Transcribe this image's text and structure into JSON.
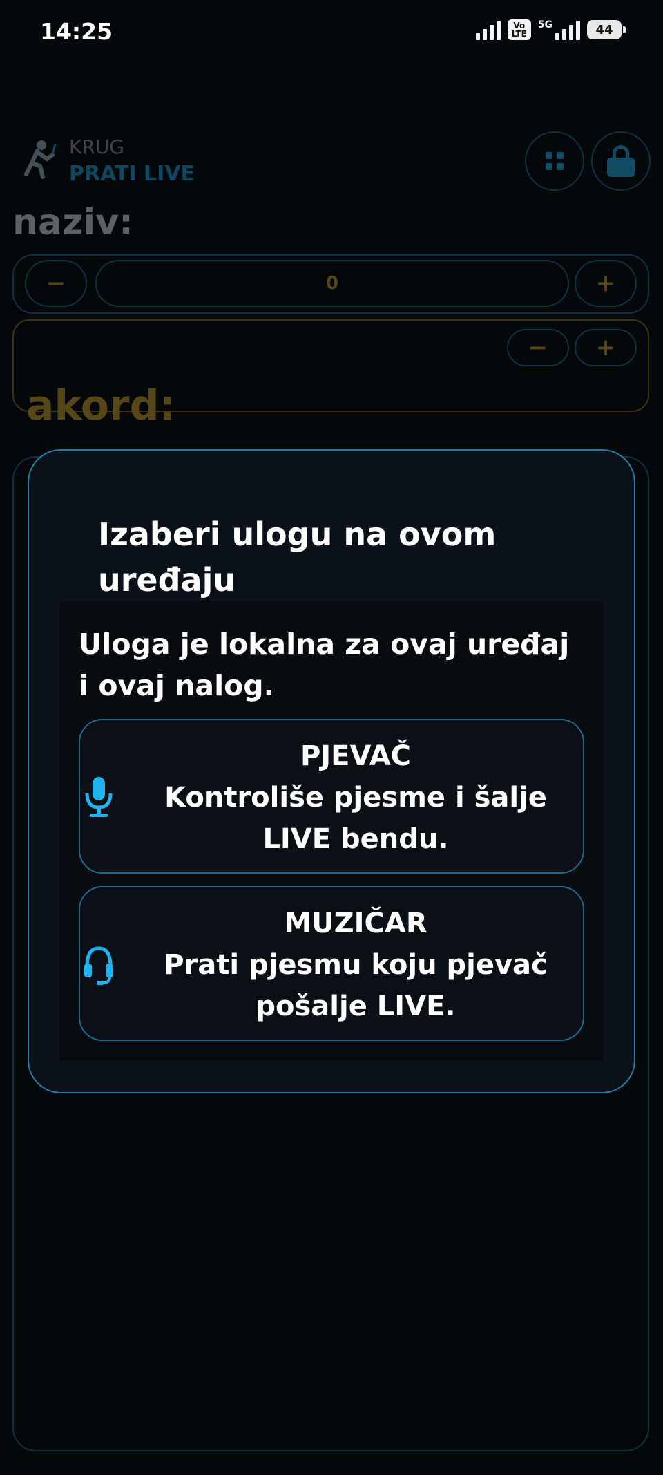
{
  "status_bar": {
    "time": "14:25",
    "volte_label_top": "Vo",
    "volte_label_bottom": "LTE",
    "network_label": "5G",
    "battery": "44"
  },
  "app": {
    "brand_label": "KRUG",
    "brand_subtitle": "PRATI LIVE",
    "title_label": "naziv:",
    "minus_symbol": "−",
    "plus_symbol": "+",
    "counter_value": "0",
    "chord_label": "akord:",
    "accent_color": "#1f9fd6",
    "gold_color": "#c79b2b"
  },
  "modal": {
    "title": "Izaberi ulogu na ovom uređaju",
    "description": "Uloga je lokalna za ovaj uređaj i ovaj nalog.",
    "roles": [
      {
        "icon": "microphone-icon",
        "name": "PJEVAČ",
        "description": "Kontroliše pjesme i šalje LIVE bendu."
      },
      {
        "icon": "headset-icon",
        "name": "MUZIČAR",
        "description": "Prati pjesmu koju pjevač pošalje LIVE."
      }
    ]
  }
}
